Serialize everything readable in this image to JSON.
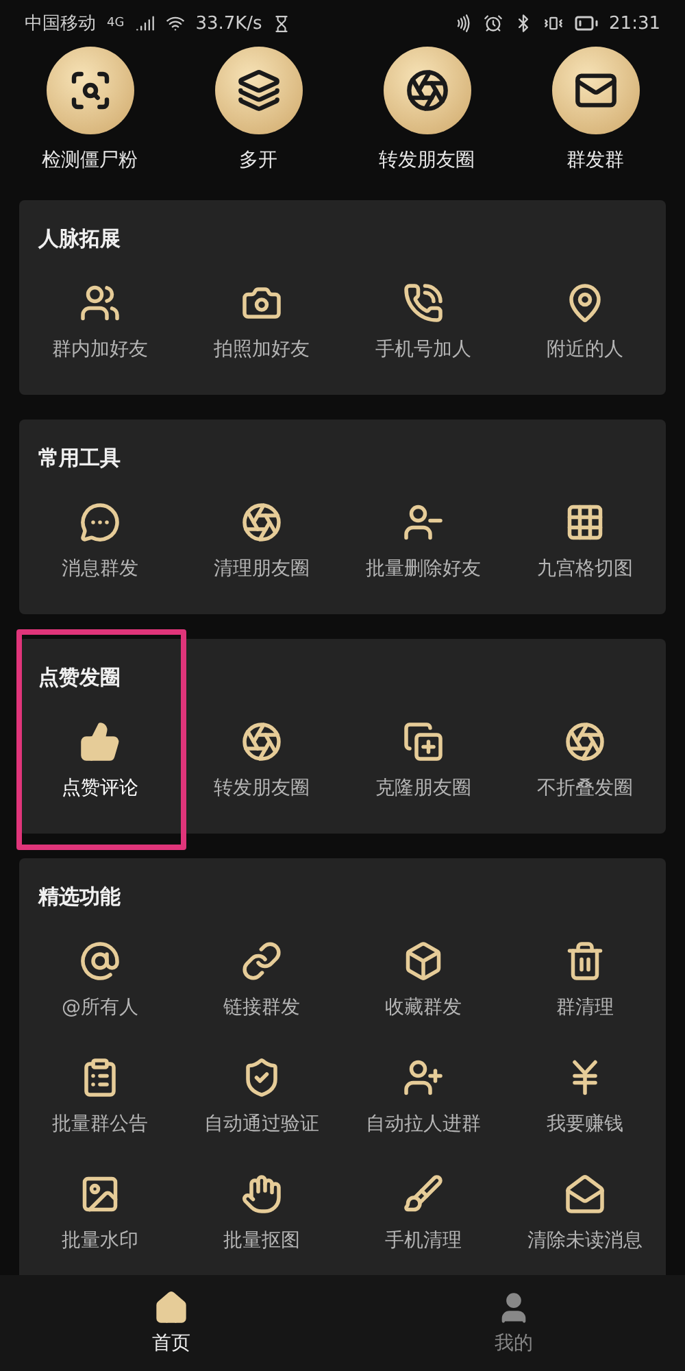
{
  "status_bar": {
    "carrier": "中国移动",
    "network": "4G",
    "speed": "33.7K/s",
    "time": "21:31"
  },
  "shortcuts": [
    {
      "label": "检测僵尸粉"
    },
    {
      "label": "多开"
    },
    {
      "label": "转发朋友圈"
    },
    {
      "label": "群发群"
    }
  ],
  "sections": [
    {
      "title": "人脉拓展",
      "items": [
        {
          "label": "群内加好友",
          "highlighted": false
        },
        {
          "label": "拍照加好友",
          "highlighted": false
        },
        {
          "label": "手机号加人",
          "highlighted": false
        },
        {
          "label": "附近的人",
          "highlighted": false
        }
      ]
    },
    {
      "title": "常用工具",
      "items": [
        {
          "label": "消息群发",
          "highlighted": false
        },
        {
          "label": "清理朋友圈",
          "highlighted": false
        },
        {
          "label": "批量删除好友",
          "highlighted": false
        },
        {
          "label": "九宫格切图",
          "highlighted": false
        }
      ]
    },
    {
      "title": "点赞发圈",
      "items": [
        {
          "label": "点赞评论",
          "highlighted": true
        },
        {
          "label": "转发朋友圈",
          "highlighted": false
        },
        {
          "label": "克隆朋友圈",
          "highlighted": false
        },
        {
          "label": "不折叠发圈",
          "highlighted": false
        }
      ]
    },
    {
      "title": "精选功能",
      "items": [
        {
          "label": "@所有人",
          "highlighted": false
        },
        {
          "label": "链接群发",
          "highlighted": false
        },
        {
          "label": "收藏群发",
          "highlighted": false
        },
        {
          "label": "群清理",
          "highlighted": false
        },
        {
          "label": "批量群公告",
          "highlighted": false
        },
        {
          "label": "自动通过验证",
          "highlighted": false
        },
        {
          "label": "自动拉人进群",
          "highlighted": false
        },
        {
          "label": "我要赚钱",
          "highlighted": false
        },
        {
          "label": "批量水印",
          "highlighted": false
        },
        {
          "label": "批量抠图",
          "highlighted": false
        },
        {
          "label": "手机清理",
          "highlighted": false
        },
        {
          "label": "清除未读消息",
          "highlighted": false
        }
      ]
    }
  ],
  "bottom_nav": [
    {
      "label": "首页",
      "selected": true
    },
    {
      "label": "我的",
      "selected": false
    }
  ]
}
